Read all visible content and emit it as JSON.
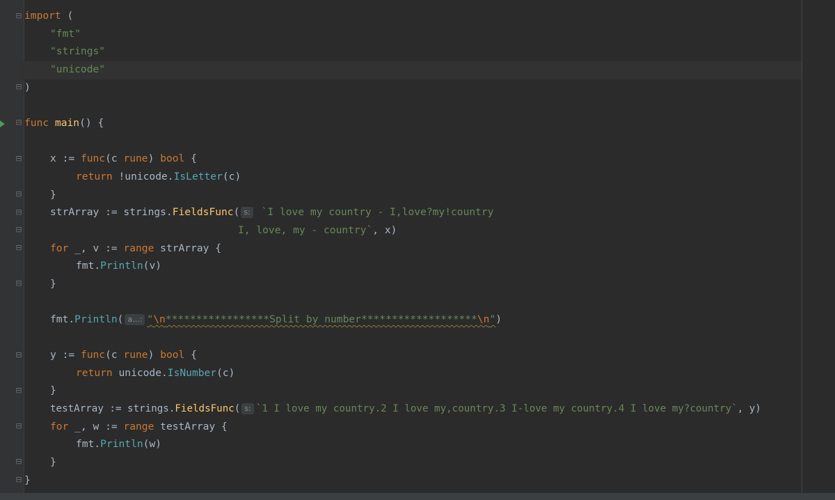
{
  "code": {
    "l1": {
      "kw": "import",
      "rest": " ("
    },
    "l2": {
      "str": "\"fmt\""
    },
    "l3": {
      "str": "\"strings\""
    },
    "l4": {
      "str": "\"unicode\""
    },
    "l5": {
      "text": ")"
    },
    "l7": {
      "kw": "func",
      "name": "main",
      "rest": "() {"
    },
    "l9": {
      "a": "x := ",
      "kw": "func",
      "b": "(c ",
      "ty": "rune",
      "c": ") ",
      "ty2": "bool",
      "d": " {"
    },
    "l10": {
      "kw": "return",
      "a": " !unicode.",
      "call": "IsLetter",
      "b": "(c)"
    },
    "l11": {
      "text": "}"
    },
    "l12": {
      "a": "strArray := strings.",
      "call": "FieldsFunc",
      "b": "(",
      "hint": "s:",
      "str": " `I love my country - I,love?my!country"
    },
    "l13": {
      "str": "I, love, my - country`",
      "b": ", x)"
    },
    "l14": {
      "kw": "for",
      "a": " _, v := ",
      "kw2": "range",
      "b": " strArray {"
    },
    "l15": {
      "a": "fmt.",
      "call": "Println",
      "b": "(v)"
    },
    "l16": {
      "text": "}"
    },
    "l18": {
      "a": "fmt.",
      "call": "Println",
      "b": "(",
      "hint": "a...:",
      "q1": "\"",
      "esc1": "\\n",
      "str": "*****************Split by number*******************",
      "esc2": "\\n",
      "q2": "\"",
      "c": ")"
    },
    "l20": {
      "a": "y := ",
      "kw": "func",
      "b": "(c ",
      "ty": "rune",
      "c": ") ",
      "ty2": "bool",
      "d": " {"
    },
    "l21": {
      "kw": "return",
      "a": " unicode.",
      "call": "IsNumber",
      "b": "(c)"
    },
    "l22": {
      "text": "}"
    },
    "l23": {
      "a": "testArray := strings.",
      "call": "FieldsFunc",
      "b": "(",
      "hint": "s:",
      "str": "`1 I love my country.2 I love my,country.3 I-love my country.4 I love my?country`",
      "c": ", y)"
    },
    "l24": {
      "kw": "for",
      "a": " _, w := ",
      "kw2": "range",
      "b": " testArray {"
    },
    "l25": {
      "a": "fmt.",
      "call": "Println",
      "b": "(w)"
    },
    "l26": {
      "text": "}"
    },
    "l27": {
      "text": "}"
    }
  },
  "colors": {
    "background": "#2b2b2b",
    "keyword": "#cc7832",
    "function": "#ffc66d",
    "string": "#6a8759",
    "text": "#a9b7c6",
    "run_icon": "#499c54"
  }
}
